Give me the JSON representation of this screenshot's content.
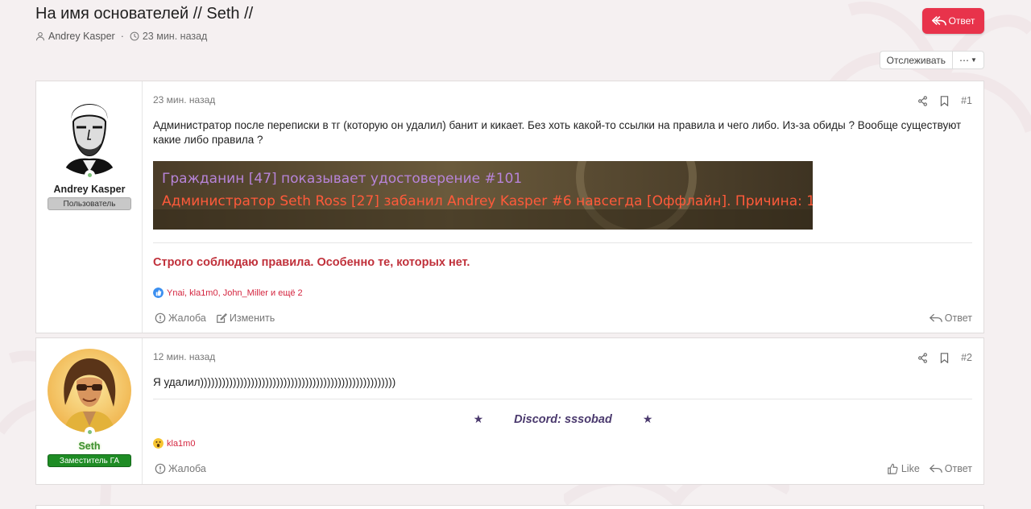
{
  "thread": {
    "title": "На имя основателей // Seth //",
    "author": "Andrey Kasper",
    "time": "23 мин. назад",
    "reply_button": "Ответ",
    "watch_button": "Отслеживать",
    "more_button": "⋯"
  },
  "posts": [
    {
      "number": "#1",
      "date": "23 мин. назад",
      "user": {
        "name": "Andrey Kasper",
        "title": "Пользователь"
      },
      "text": "Администратор после переписки в тг (которую он удалил) банит и кикает. Без хоть какой-то ссылки на правила и чего либо. Из-за обиды ? Вообще существуют какие либо правила ?",
      "screenshot_lines": [
        "Гражданин [47] показывает удостоверение #101",
        "Администратор Seth Ross [27] забанил Andrey Kasper #6 навсегда [Оффлайн]. Причина: 1"
      ],
      "signature": "Строго соблюдаю правила. Особенно те, которых нет.",
      "reactions": "Ynai, kla1m0, John_Miller и ещё 2",
      "actions": {
        "report": "Жалоба",
        "edit": "Изменить",
        "reply": "Ответ"
      }
    },
    {
      "number": "#2",
      "date": "12 мин. назад",
      "user": {
        "name": "Seth",
        "title": "Заместитель ГА"
      },
      "text": "Я удалил))))))))))))))))))))))))))))))))))))))))))))))))))))))",
      "signature": "Discord: sssobad",
      "signature_star": "★",
      "reactions": "kla1m0",
      "actions": {
        "report": "Жалоба",
        "like": "Like",
        "reply": "Ответ"
      }
    }
  ],
  "colors": {
    "accent": "#e8334b",
    "user_title_default_bg": "#c8c8c8",
    "user_title_staff_bg": "#1e8c24",
    "username_staff": "#3c8f2f",
    "signature_red": "#c0303a",
    "signature_discord": "#4b3a6e",
    "reaction_link": "#d4253f"
  },
  "icons": {
    "user": "user-icon",
    "clock": "clock-icon",
    "share": "share-icon",
    "bookmark": "bookmark-icon",
    "report": "alert-circle-icon",
    "edit": "edit-icon",
    "reply": "reply-icon",
    "like": "thumbs-up-icon",
    "reaction_like": "like-reaction-icon",
    "reaction_wow": "wow-reaction-icon"
  }
}
